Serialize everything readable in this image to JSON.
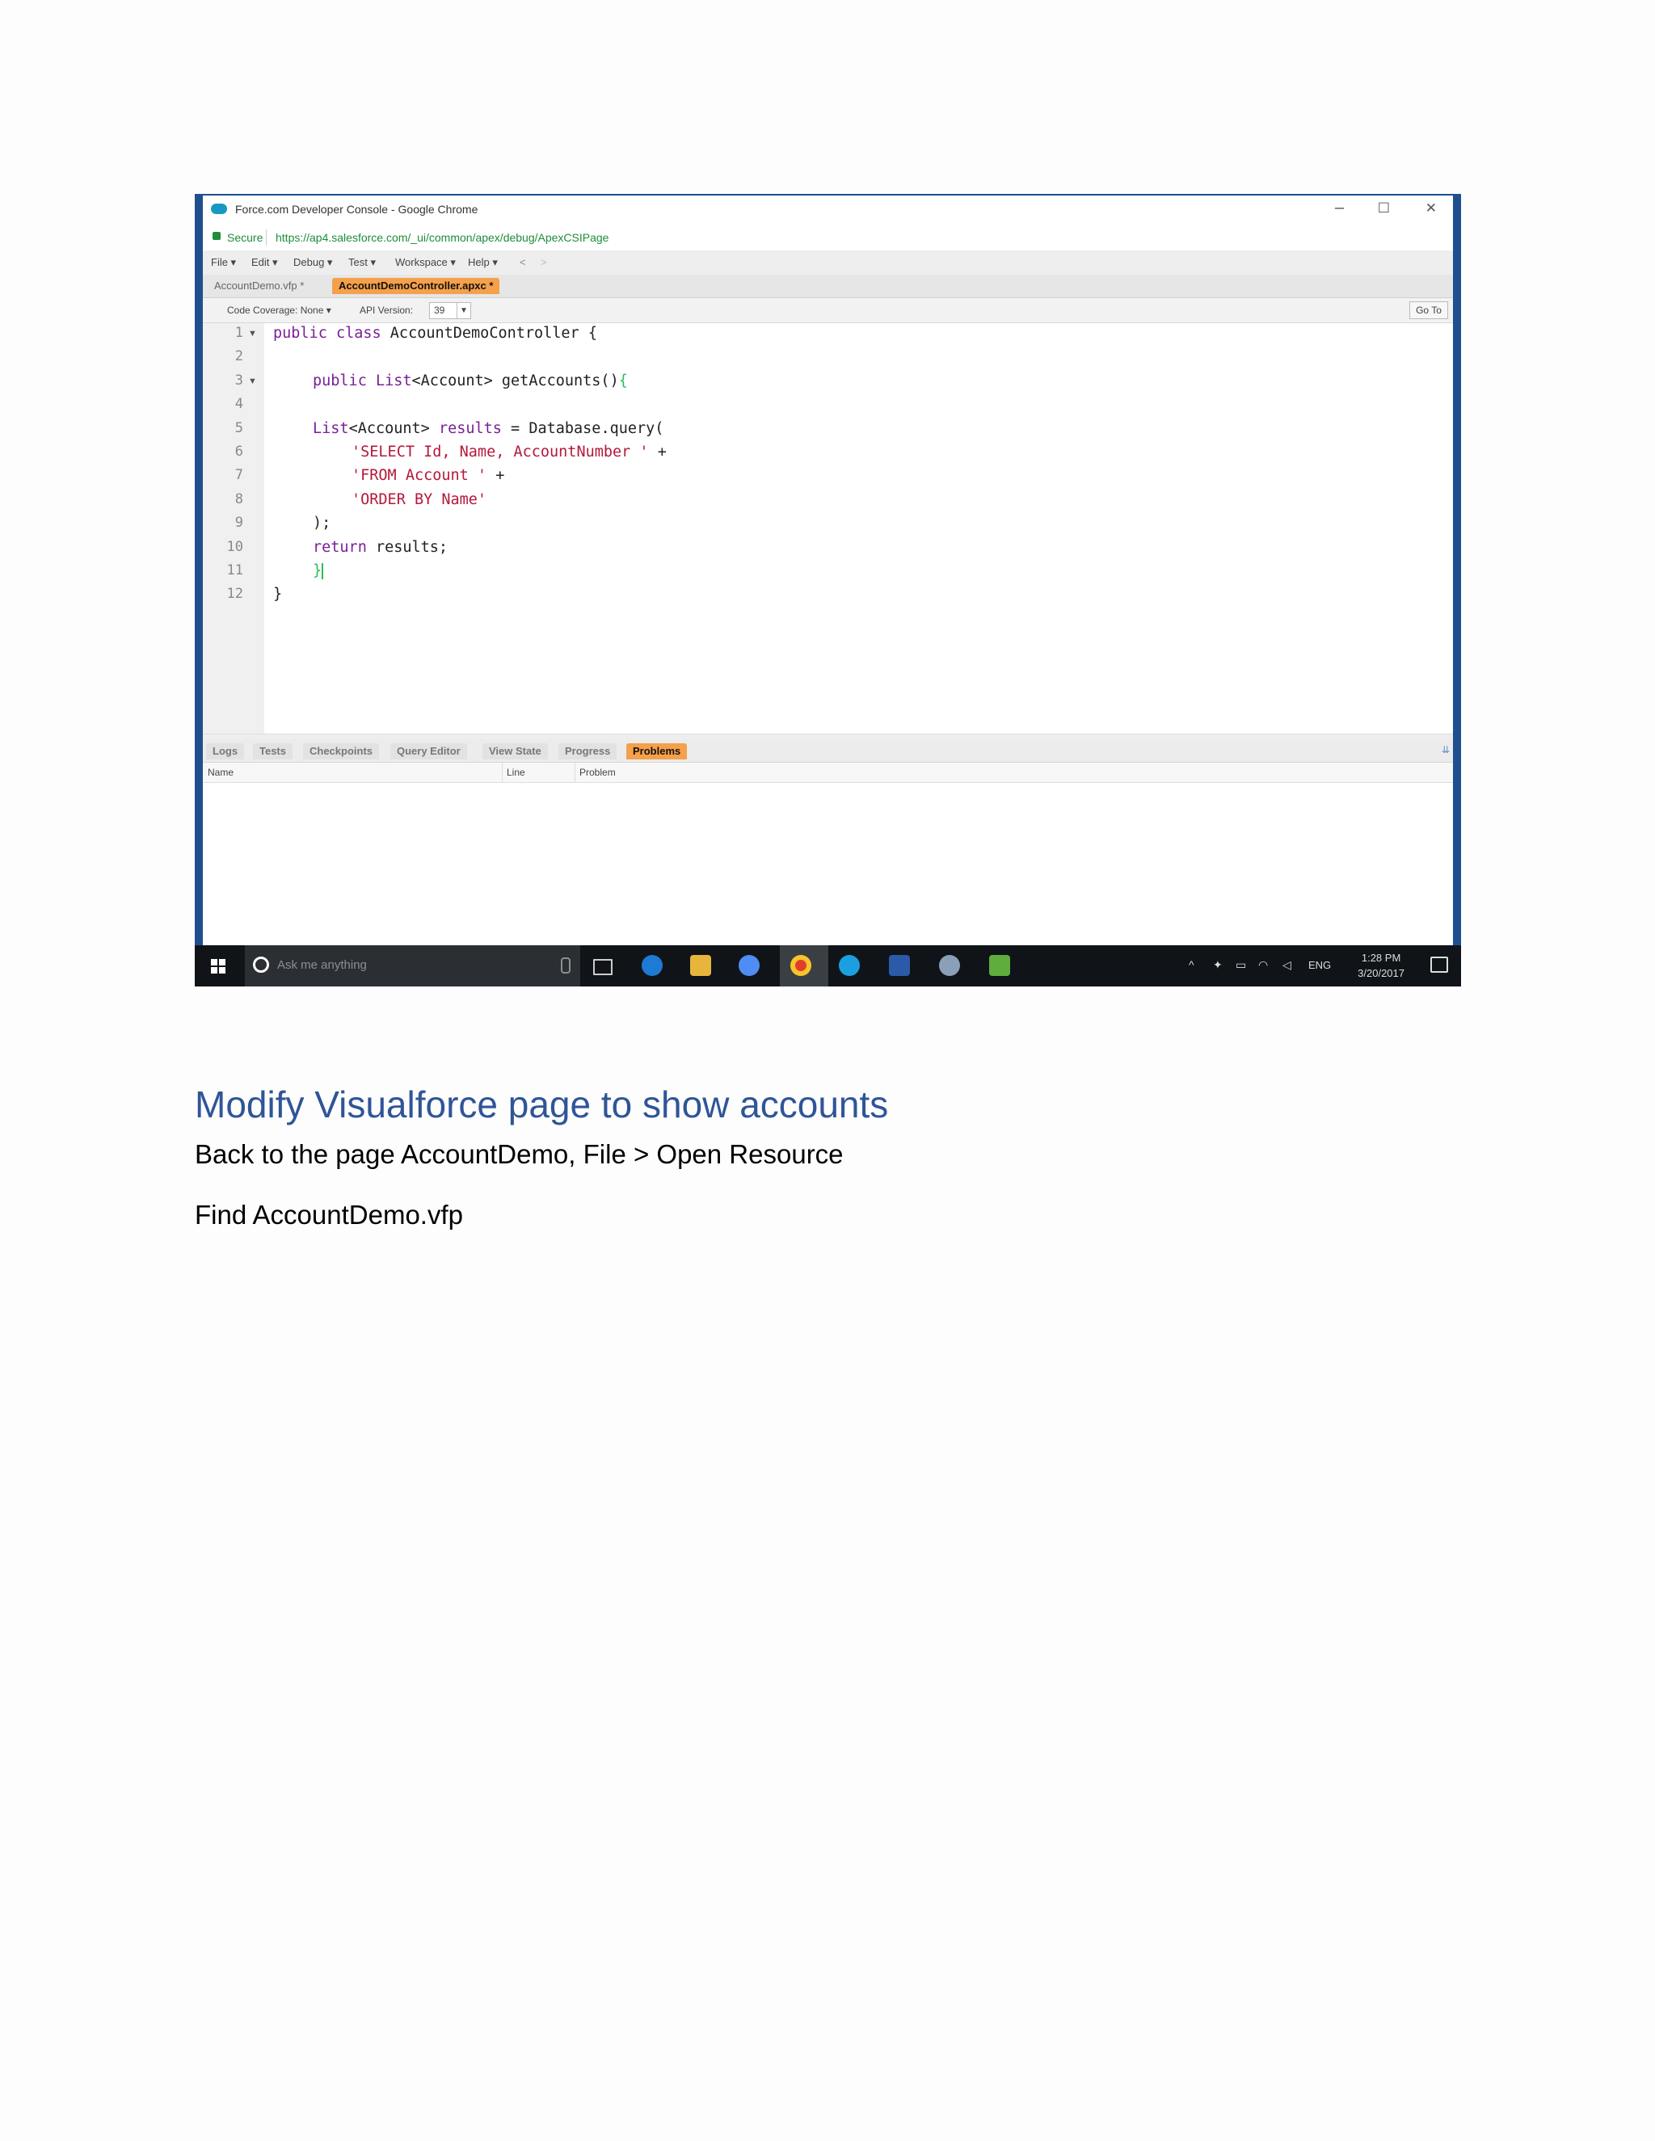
{
  "window": {
    "title": "Force.com Developer Console - Google Chrome",
    "controls": {
      "minimize": "–",
      "maximize": "☐",
      "close": "✕"
    }
  },
  "address_bar": {
    "secure_label": "Secure",
    "url": "https://ap4.salesforce.com/_ui/common/apex/debug/ApexCSIPage"
  },
  "menu": [
    "File ▾",
    "Edit ▾",
    "Debug ▾",
    "Test ▾",
    "Workspace ▾",
    "Help ▾",
    "<",
    ">"
  ],
  "file_tabs": [
    {
      "label": "AccountDemo.vfp *",
      "active": false
    },
    {
      "label": "AccountDemoController.apxc *",
      "active": true
    }
  ],
  "toolbar": {
    "coverage": "Code Coverage: None ▾",
    "api_label": "API Version:",
    "api_value": "39",
    "goto": "Go To"
  },
  "code_lines": [
    "1",
    "2",
    "3",
    "4",
    "5",
    "6",
    "7",
    "8",
    "9",
    "10",
    "11",
    "12"
  ],
  "code": {
    "l1_kw": "public class ",
    "l1_rest": "AccountDemoController {",
    "l3_kw": "public ",
    "l3_ty": "List",
    "l3_rest": "<Account> getAccounts()",
    "l3_br": "{",
    "l5_ty": "List",
    "l5_rest1": "<Account> ",
    "l5_kw": "results",
    "l5_rest2": " = Database.query(",
    "l6_str": "'SELECT Id, Name, AccountNumber '",
    "l6_rest": " +",
    "l7_str": "'FROM Account '",
    "l7_rest": " +",
    "l8_str": "'ORDER BY Name'",
    "l9": ");",
    "l10_kw": "return",
    "l10_rest": " results;",
    "l11_br": "}",
    "l12": "}"
  },
  "panel_tabs": [
    {
      "label": "Logs",
      "active": false
    },
    {
      "label": "Tests",
      "active": false
    },
    {
      "label": "Checkpoints",
      "active": false
    },
    {
      "label": "Query Editor",
      "active": false
    },
    {
      "label": "View State",
      "active": false
    },
    {
      "label": "Progress",
      "active": false
    },
    {
      "label": "Problems",
      "active": true
    }
  ],
  "problem_columns": {
    "name": "Name",
    "line": "Line",
    "problem": "Problem"
  },
  "taskbar": {
    "search_placeholder": "Ask me anything",
    "language": "ENG",
    "time": "1:28 PM",
    "date": "3/20/2017"
  },
  "document": {
    "heading": "Modify Visualforce page to show accounts",
    "para1": "Back to the page AccountDemo, File > Open Resource",
    "para2": "Find AccountDemo.vfp"
  },
  "colors": {
    "heading": "#2f5597",
    "active_tab": "#f5a04a",
    "keyword": "#7a1f96",
    "string": "#b3193a"
  }
}
